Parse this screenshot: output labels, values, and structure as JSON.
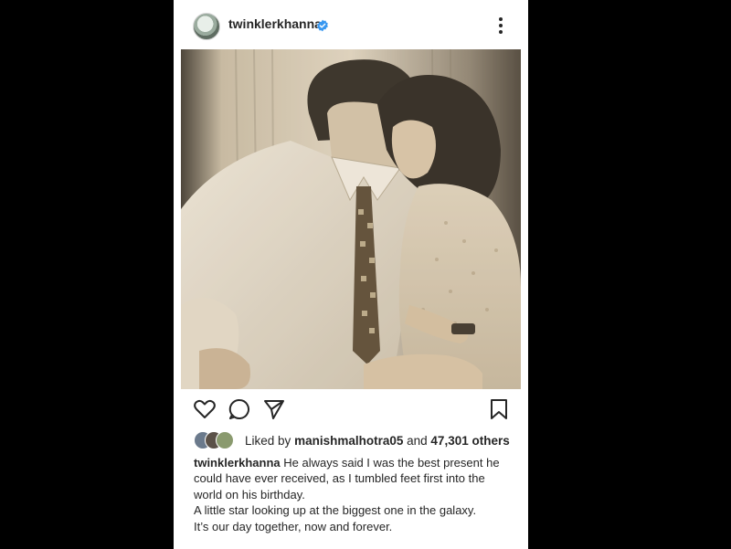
{
  "post": {
    "username": "twinklerkhanna",
    "liked_by_prefix": "Liked by",
    "liked_by_user": "manishmalhotra05",
    "liked_by_and": "and",
    "liked_by_count": "47,301 others",
    "caption_username": "twinklerkhanna",
    "caption_line1": "He always said I was the best present he could have ever received, as I tumbled feet first into the world on his birthday.",
    "caption_line2": "A little star looking up at the biggest one in the galaxy.",
    "caption_line3": "It’s our day together, now and  forever."
  },
  "icons": {
    "verified": "verified-badge-icon",
    "more": "more-options-icon",
    "like": "heart-icon",
    "comment": "comment-icon",
    "share": "share-icon",
    "save": "bookmark-icon"
  },
  "colors": {
    "background": "#000000",
    "card": "#ffffff",
    "text": "#262626",
    "verified": "#3897f0",
    "photo_tone": "#ddd3c2"
  }
}
